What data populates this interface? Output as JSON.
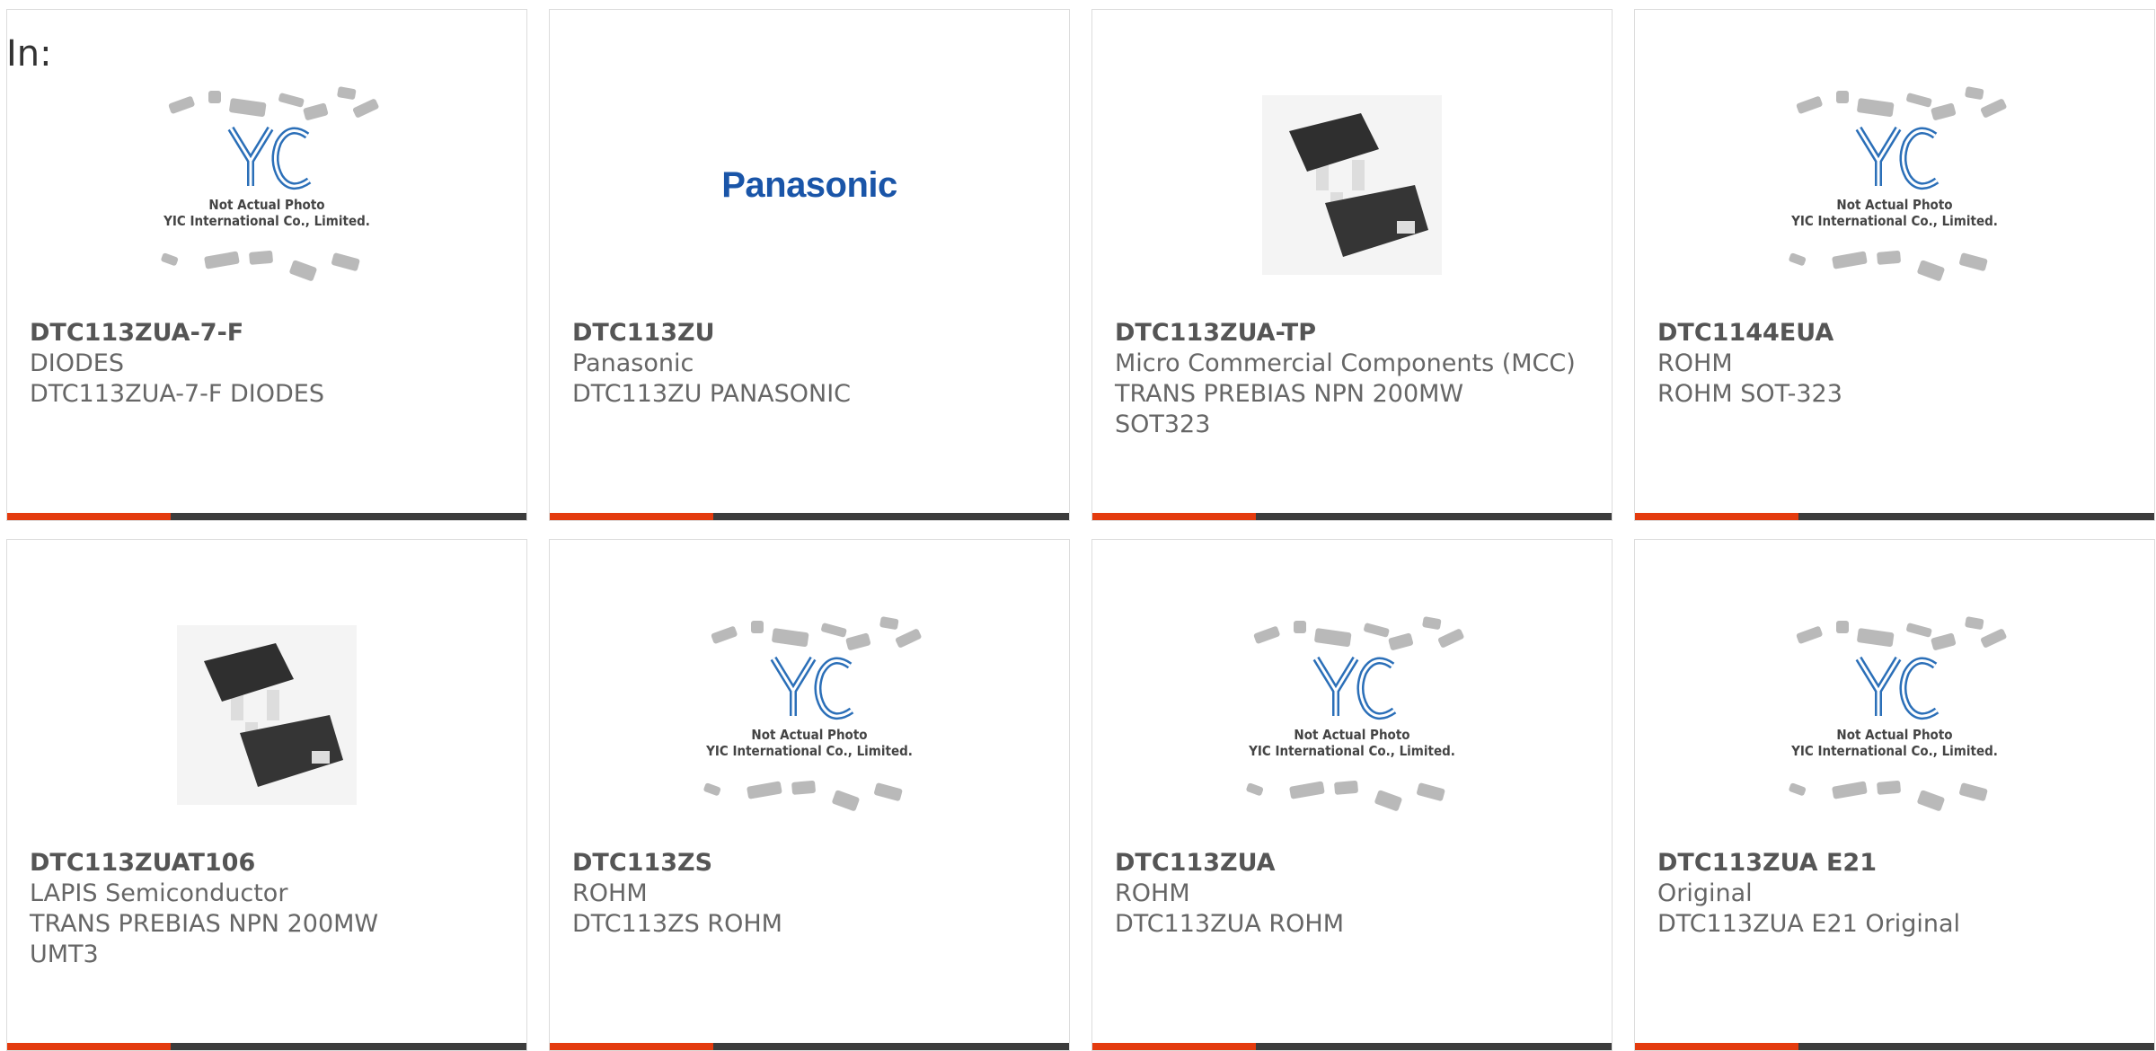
{
  "page": {
    "in_label": "In:"
  },
  "placeholder": {
    "line1": "Not Actual Photo",
    "line2": "YIC International Co., Limited."
  },
  "brand": {
    "logo_text": "Panasonic",
    "accent": "#1a55a8"
  },
  "colors": {
    "accent_bar": "#e43b0e",
    "dark_bar": "#3c3c3c",
    "yic_blue": "#2b6fb8"
  },
  "cards": [
    {
      "part": "DTC113ZUA-7-F",
      "manufacturer": "DIODES",
      "description": "DTC113ZUA-7-F DIODES",
      "image": "yic-placeholder"
    },
    {
      "part": "DTC113ZU",
      "manufacturer": "Panasonic",
      "description": "DTC113ZU PANASONIC",
      "image": "panasonic-logo"
    },
    {
      "part": "DTC113ZUA-TP",
      "manufacturer": "Micro Commercial Components (MCC)",
      "description": "TRANS PREBIAS NPN 200MW SOT323",
      "image": "sot323-photo"
    },
    {
      "part": "DTC1144EUA",
      "manufacturer": "ROHM",
      "description": "ROHM SOT-323",
      "image": "yic-placeholder"
    },
    {
      "part": "DTC113ZUAT106",
      "manufacturer": "LAPIS Semiconductor",
      "description": "TRANS PREBIAS NPN 200MW UMT3",
      "image": "umt3-photo"
    },
    {
      "part": "DTC113ZS",
      "manufacturer": "ROHM",
      "description": "DTC113ZS ROHM",
      "image": "yic-placeholder"
    },
    {
      "part": "DTC113ZUA",
      "manufacturer": "ROHM",
      "description": "DTC113ZUA ROHM",
      "image": "yic-placeholder"
    },
    {
      "part": "DTC113ZUA E21",
      "manufacturer": "Original",
      "description": "DTC113ZUA E21 Original",
      "image": "yic-placeholder"
    }
  ]
}
